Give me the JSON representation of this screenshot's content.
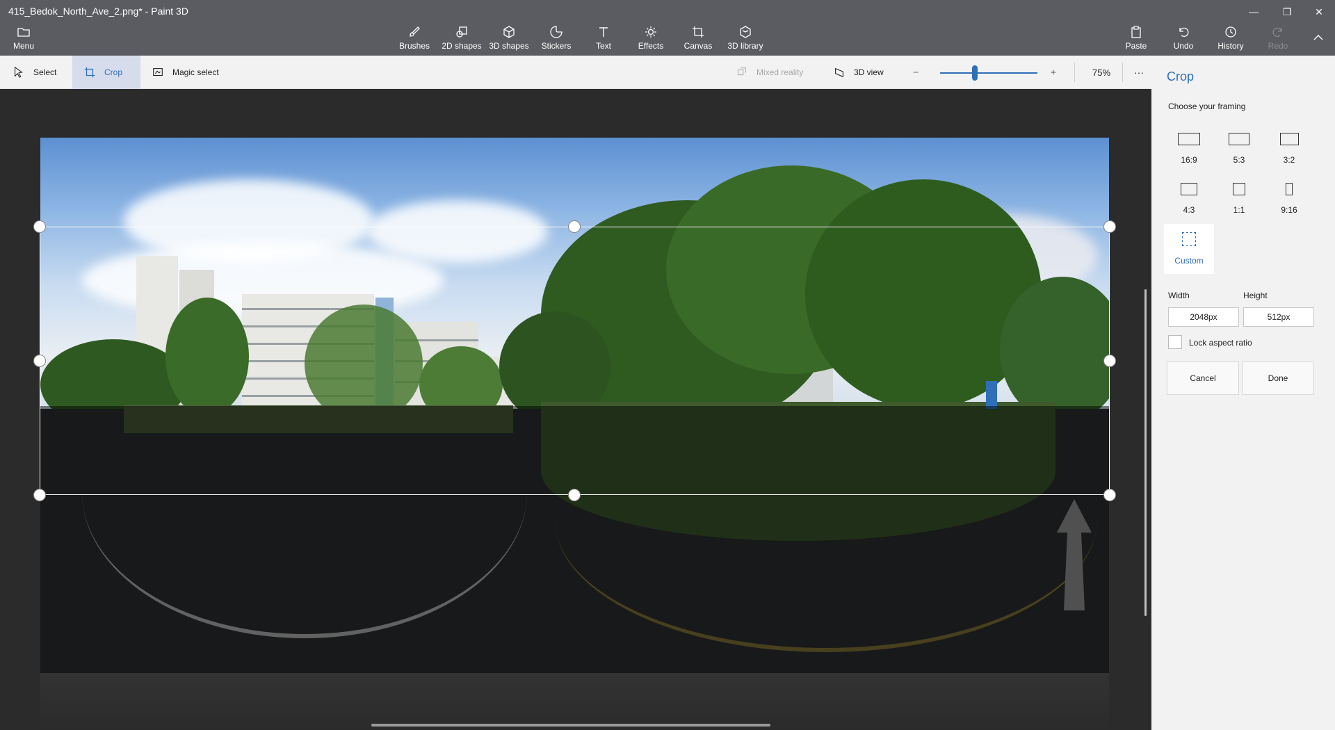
{
  "window": {
    "title": "415_Bedok_North_Ave_2.png* - Paint 3D",
    "minimize_glyph": "—",
    "restore_glyph": "❐",
    "close_glyph": "✕"
  },
  "ribbon": {
    "menu": "Menu",
    "brushes": "Brushes",
    "shapes_2d": "2D shapes",
    "shapes_3d": "3D shapes",
    "stickers": "Stickers",
    "text": "Text",
    "effects": "Effects",
    "canvas": "Canvas",
    "library_3d": "3D library",
    "paste": "Paste",
    "undo": "Undo",
    "history": "History",
    "redo": "Redo"
  },
  "toolbar": {
    "select": "Select",
    "crop": "Crop",
    "magic_select": "Magic select",
    "mixed_reality": "Mixed reality",
    "view_3d": "3D view",
    "zoom_percent": "75%",
    "zoom_fraction": 0.36,
    "more": "···"
  },
  "panel": {
    "title": "Crop",
    "subtitle": "Choose your framing",
    "framings": [
      {
        "label": "16:9"
      },
      {
        "label": "5:3"
      },
      {
        "label": "3:2"
      },
      {
        "label": "4:3"
      },
      {
        "label": "1:1"
      },
      {
        "label": "9:16"
      },
      {
        "label": "Custom"
      }
    ],
    "width_label": "Width",
    "height_label": "Height",
    "width_value": "2048px",
    "height_value": "512px",
    "lock_label": "Lock aspect ratio",
    "cancel": "Cancel",
    "done": "Done"
  },
  "colors": {
    "accent": "#2f6fb7",
    "ribbon": "#5a5c61",
    "toolbar": "#f2f2f2",
    "workspace": "#2b2b2b"
  }
}
